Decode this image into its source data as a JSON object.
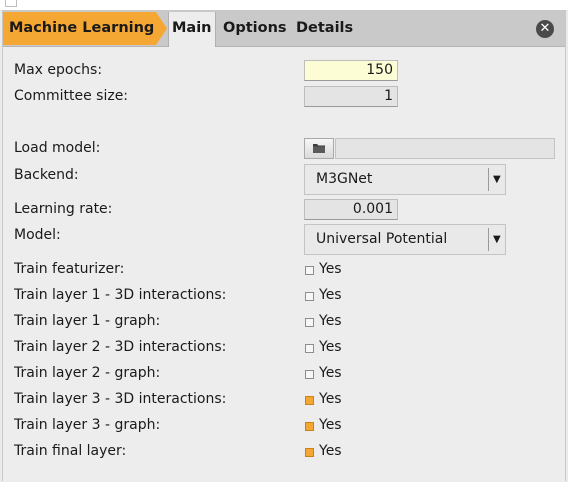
{
  "tabs": {
    "breadcrumb": "Machine Learning",
    "main": "Main",
    "options": "Options",
    "details": "Details"
  },
  "icons": {
    "close": "close-icon",
    "folder": "folder-icon",
    "dropdown": "chevron-down-icon"
  },
  "colors": {
    "accent": "#f5a733",
    "highlight_field": "#fdfdd5"
  },
  "form": {
    "max_epochs": {
      "label": "Max epochs:",
      "value": "150"
    },
    "committee_size": {
      "label": "Committee size:",
      "value": "1"
    },
    "load_model": {
      "label": "Load model:",
      "value": ""
    },
    "backend": {
      "label": "Backend:",
      "selected": "M3GNet"
    },
    "learning_rate": {
      "label": "Learning rate:",
      "value": "0.001"
    },
    "model": {
      "label": "Model:",
      "selected": "Universal Potential"
    }
  },
  "training": [
    {
      "label": "Train featurizer:",
      "option": "Yes",
      "checked": false
    },
    {
      "label": "Train layer 1 - 3D interactions:",
      "option": "Yes",
      "checked": false
    },
    {
      "label": "Train layer 1 - graph:",
      "option": "Yes",
      "checked": false
    },
    {
      "label": "Train layer 2 - 3D interactions:",
      "option": "Yes",
      "checked": false
    },
    {
      "label": "Train layer 2 - graph:",
      "option": "Yes",
      "checked": false
    },
    {
      "label": "Train layer 3 - 3D interactions:",
      "option": "Yes",
      "checked": true
    },
    {
      "label": "Train layer 3 - graph:",
      "option": "Yes",
      "checked": true
    },
    {
      "label": "Train final layer:",
      "option": "Yes",
      "checked": true
    }
  ]
}
